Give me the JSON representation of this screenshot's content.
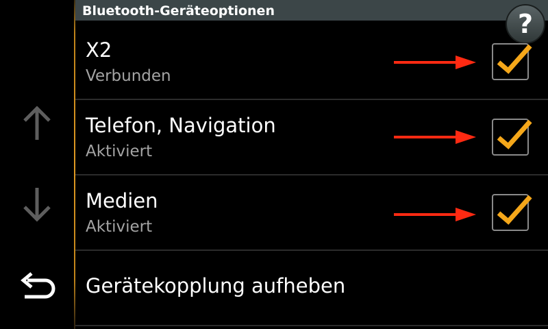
{
  "header": {
    "title": "Bluetooth-Geräteoptionen",
    "help_label": "?"
  },
  "sidebar": {
    "up_icon": "arrow-up-icon",
    "down_icon": "arrow-down-icon",
    "back_icon": "back-return-icon"
  },
  "rows": [
    {
      "title": "X2",
      "subtitle": "Verbunden",
      "checked": true
    },
    {
      "title": "Telefon, Navigation",
      "subtitle": "Aktiviert",
      "checked": true
    },
    {
      "title": "Medien",
      "subtitle": "Aktiviert",
      "checked": true
    }
  ],
  "action": {
    "label": "Gerätekopplung aufheben"
  },
  "colors": {
    "header_bg": "#3c4648",
    "check_orange": "#f5a71a",
    "annotation_red": "#ff2a12",
    "subtitle_gray": "#a4a4a4"
  }
}
